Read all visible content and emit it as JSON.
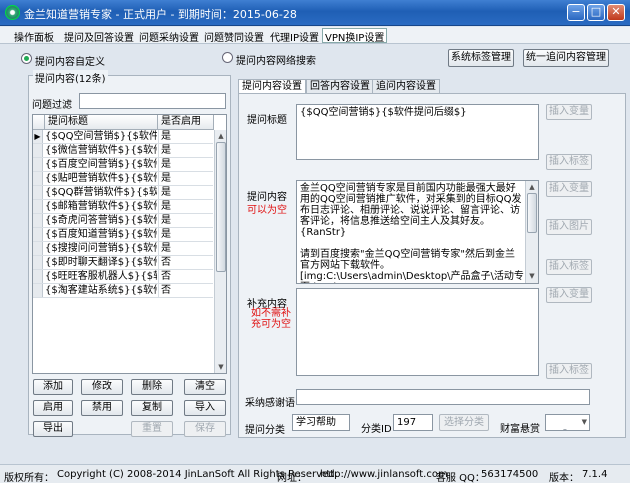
{
  "window": {
    "title": "金兰知道营销专家 - 正式用户 - 到期时间：2015-06-28",
    "minimize": "−",
    "maximize": "□",
    "close": "✕"
  },
  "menu": [
    "操作面板",
    "提问及回答设置",
    "问题采纳设置",
    "问题赞同设置",
    "代理IP设置",
    "VPN换IP设置"
  ],
  "mode": {
    "custom_label": "提问内容自定义",
    "search_label": "提问内容网络搜索",
    "system_tags_button": "系统标签管理",
    "unified_manage_button": "统一追问内容管理"
  },
  "left": {
    "group_label": "提问内容(12条)",
    "filter_label": "问题过滤",
    "filter_value": "",
    "columns": [
      "提问标题",
      "是否启用"
    ],
    "rows": [
      {
        "title": "{$QQ空间营销$}{$软件提问后缀$}",
        "enabled": "是"
      },
      {
        "title": "{$微信营销软件$}{$软件提问后缀$}",
        "enabled": "是"
      },
      {
        "title": "{$百度空间营销$}{$软件提问后缀$}",
        "enabled": "是"
      },
      {
        "title": "{$贴吧营销软件$}{$软件提问后缀$}",
        "enabled": "是"
      },
      {
        "title": "{$QQ群营销软件$}{$软件提问后缀$}",
        "enabled": "是"
      },
      {
        "title": "{$邮箱营销软件$}{$软件提问后缀$}",
        "enabled": "是"
      },
      {
        "title": "{$奇虎问答营销$}{$软件提问后缀$}",
        "enabled": "是"
      },
      {
        "title": "{$百度知道营销$}{$软件提问后缀$}",
        "enabled": "是"
      },
      {
        "title": "{$搜搜问问营销$}{$软件提问后缀$}",
        "enabled": "是"
      },
      {
        "title": "{$即时聊天翻译$}{$软件提问后缀$}",
        "enabled": "否"
      },
      {
        "title": "{$旺旺客服机器人$}{$软件提问后缀$}",
        "enabled": "否"
      },
      {
        "title": "{$淘客建站系统$}{$软件提问后缀$}",
        "enabled": "否"
      }
    ],
    "buttons": {
      "add": "添加",
      "edit": "修改",
      "delete": "删除",
      "clear": "清空",
      "enable": "启用",
      "disable": "禁用",
      "copy": "复制",
      "import": "导入",
      "export": "导出",
      "reset": "重置",
      "save": "保存"
    }
  },
  "right": {
    "tabs": [
      "提问内容设置",
      "回答内容设置",
      "追问内容设置"
    ],
    "title_label": "提问标题",
    "title_value": "{$QQ空间营销$}{$软件提问后缀$}",
    "content_label": "提问内容",
    "content_note": "可以为空",
    "content_value": "金兰QQ空间营销专家是目前国内功能最强大最好用的QQ空间营销推广软件，对采集到的目标QQ发布日志评论、相册评论、说说评论、留言评论、访客评论，将信息推送给空间主人及其好友。{RanStr}\n\n请到百度搜索\"金兰QQ空间营销专家\"然后到金兰官方网站下载软件。\n[img:C:\\Users\\admin\\Desktop\\产品盒子\\活动专页\\html",
    "extra_label": "补充内容",
    "extra_note": "如不需补充可为空",
    "extra_value": "",
    "insert_variable": "插入变量",
    "insert_tag": "插入标签",
    "insert_image": "插入图片",
    "thanks_label": "采纳感谢语",
    "thanks_value": "",
    "category_label": "提问分类",
    "category_value": "学习帮助",
    "category_id_label": "分类ID",
    "category_id_value": "197",
    "select_category": "选择分类",
    "bounty_label": "财富悬赏",
    "bounty_value": "0"
  },
  "status": {
    "copyright_label": "版权所有：",
    "copyright_value": "Copyright (C) 2008-2014 JinLanSoft All Rights Reserved.",
    "website_label": "网址：",
    "website_value": "http://www.jinlansoft.com",
    "qq_label": "客服 QQ：",
    "qq_value": "563174500",
    "version_label": "版本：",
    "version_value": "7.1.4"
  }
}
